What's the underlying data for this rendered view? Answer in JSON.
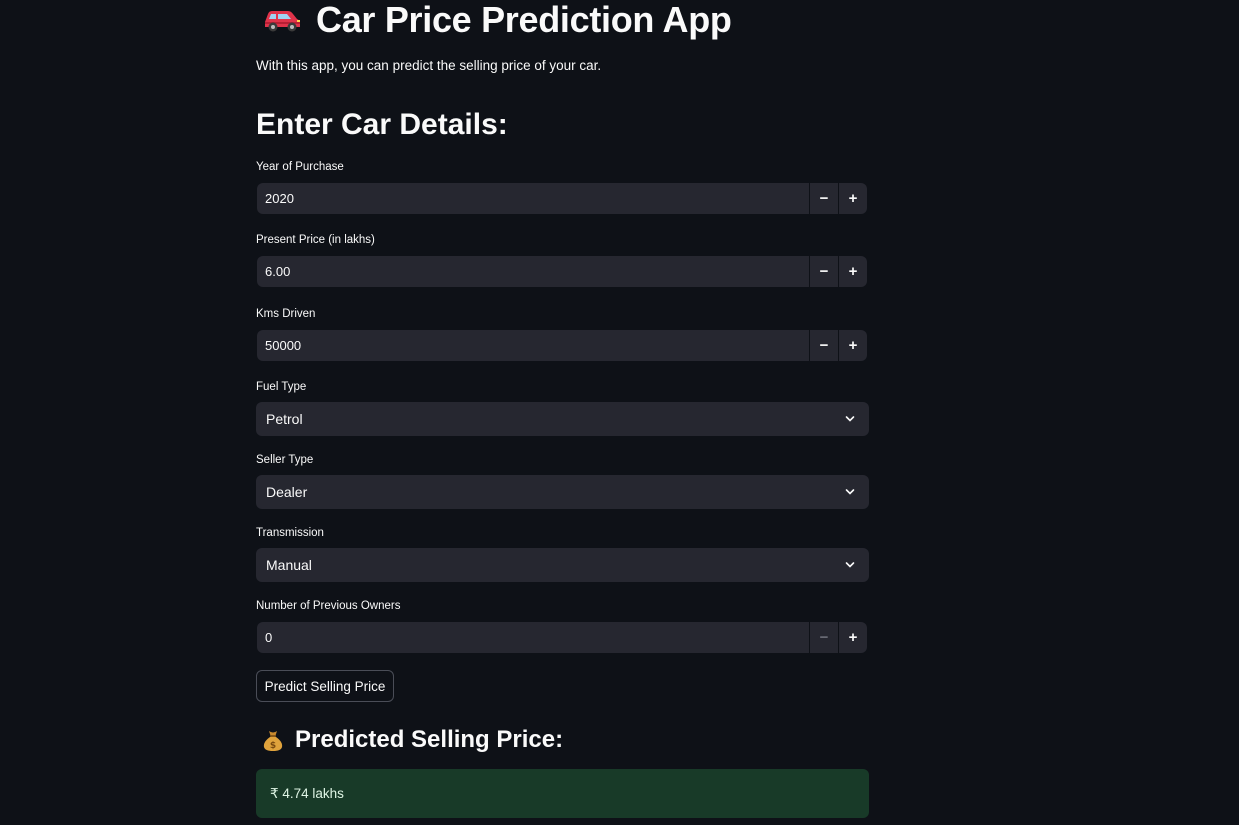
{
  "header": {
    "title_emoji": "car-emoji",
    "title": "Car Price Prediction App",
    "subtitle": "With this app, you can predict the selling price of your car."
  },
  "form": {
    "heading": "Enter Car Details:",
    "year": {
      "label": "Year of Purchase",
      "value": "2020"
    },
    "present_price": {
      "label": "Present Price (in lakhs)",
      "value": "6.00"
    },
    "kms_driven": {
      "label": "Kms Driven",
      "value": "50000"
    },
    "fuel_type": {
      "label": "Fuel Type",
      "value": "Petrol"
    },
    "seller_type": {
      "label": "Seller Type",
      "value": "Dealer"
    },
    "transmission": {
      "label": "Transmission",
      "value": "Manual"
    },
    "owners": {
      "label": "Number of Previous Owners",
      "value": "0"
    },
    "stepper": {
      "minus": "−",
      "plus": "+"
    },
    "predict_button": "Predict Selling Price"
  },
  "result": {
    "heading_emoji": "money-bag-emoji",
    "heading": "Predicted Selling Price:",
    "value": "₹ 4.74 lakhs"
  },
  "colors": {
    "background": "#0e1117",
    "input_background": "#262730",
    "success_background": "#183a28"
  }
}
